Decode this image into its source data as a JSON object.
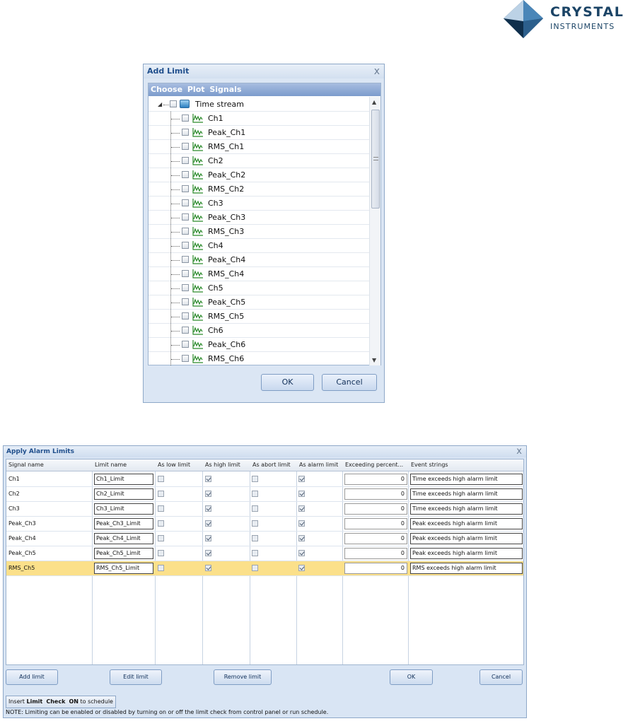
{
  "logo": {
    "line1": "CRYSTAL",
    "line2": "INSTRUMENTS",
    "icon": "diamond-logo-icon"
  },
  "add_limit": {
    "title": "Add Limit",
    "close": "x",
    "panel_header": "Choose  Plot  Signals",
    "root": "Time stream",
    "signals": [
      "Ch1",
      "Peak_Ch1",
      "RMS_Ch1",
      "Ch2",
      "Peak_Ch2",
      "RMS_Ch2",
      "Ch3",
      "Peak_Ch3",
      "RMS_Ch3",
      "Ch4",
      "Peak_Ch4",
      "RMS_Ch4",
      "Ch5",
      "Peak_Ch5",
      "RMS_Ch5",
      "Ch6",
      "Peak_Ch6",
      "RMS_Ch6"
    ],
    "ok": "OK",
    "cancel": "Cancel"
  },
  "alarm": {
    "title": "Apply Alarm Limits",
    "close": "x",
    "columns": [
      "Signal name",
      "Limit name",
      "As low limit",
      "As high limit",
      "As abort limit",
      "As alarm limit",
      "Exceeding percent...",
      "Event strings"
    ],
    "rows": [
      {
        "signal": "Ch1",
        "limit": "Ch1_Limit",
        "low": false,
        "high": true,
        "abort": false,
        "alarm": true,
        "percent": "0",
        "event": "Time exceeds high alarm limit"
      },
      {
        "signal": "Ch2",
        "limit": "Ch2_Limit",
        "low": false,
        "high": true,
        "abort": false,
        "alarm": true,
        "percent": "0",
        "event": "Time exceeds high alarm limit"
      },
      {
        "signal": "Ch3",
        "limit": "Ch3_Limit",
        "low": false,
        "high": true,
        "abort": false,
        "alarm": true,
        "percent": "0",
        "event": "Time exceeds high alarm limit"
      },
      {
        "signal": "Peak_Ch3",
        "limit": "Peak_Ch3_Limit",
        "low": false,
        "high": true,
        "abort": false,
        "alarm": true,
        "percent": "0",
        "event": "Peak exceeds high alarm limit"
      },
      {
        "signal": "Peak_Ch4",
        "limit": "Peak_Ch4_Limit",
        "low": false,
        "high": true,
        "abort": false,
        "alarm": true,
        "percent": "0",
        "event": "Peak exceeds high alarm limit"
      },
      {
        "signal": "Peak_Ch5",
        "limit": "Peak_Ch5_Limit",
        "low": false,
        "high": true,
        "abort": false,
        "alarm": true,
        "percent": "0",
        "event": "Peak exceeds high alarm limit"
      },
      {
        "signal": "RMS_Ch5",
        "limit": "RMS_Ch5_Limit",
        "low": false,
        "high": true,
        "abort": false,
        "alarm": true,
        "percent": "0",
        "event": "RMS exceeds high alarm limit",
        "selected": true
      }
    ],
    "buttons": {
      "add": "Add limit",
      "edit": "Edit limit",
      "remove": "Remove limit",
      "ok": "OK",
      "cancel": "Cancel"
    },
    "insert": {
      "pre": "Insert ",
      "b1": "Limit",
      "mid1": "  ",
      "b2": "Check",
      "mid2": "  ",
      "b3": "ON",
      "post": " to schedule"
    },
    "note": "NOTE: Limiting can be enabled or disabled by turning on or off the limit check from control panel or run schedule."
  }
}
